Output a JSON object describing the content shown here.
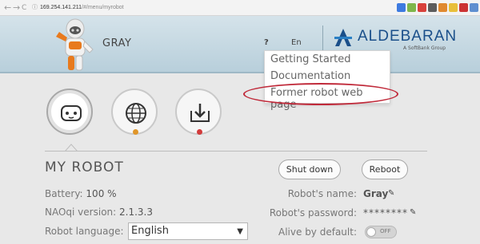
{
  "browser": {
    "url_host": "169.254.141.211",
    "url_path": "/#/menu/myrobot",
    "nav": {
      "back": "←",
      "forward": "→",
      "reload": "C",
      "info": "ⓘ"
    },
    "extension_colors": [
      "#3d7ae0",
      "#7fb64b",
      "#d8413b",
      "#5d5d5d",
      "#e0892f",
      "#e8bf3a",
      "#cc3333",
      "#5f8fd0"
    ]
  },
  "header": {
    "robot_name": "GRAY",
    "help": "?",
    "language": "En",
    "brand": "ALDEBARAN",
    "brand_sub": "A SoftBank Group",
    "brand_color": "#1a4f8a"
  },
  "dropdown": {
    "items": [
      "Getting Started",
      "Documentation",
      "Former robot web page"
    ],
    "highlight_color": "#c02a3a"
  },
  "icons": [
    {
      "name": "robot-face-icon",
      "active": true,
      "indicator": null
    },
    {
      "name": "globe-icon",
      "active": false,
      "indicator": "#e0962a"
    },
    {
      "name": "download-tray-icon",
      "active": false,
      "indicator": "#d23b3b"
    }
  ],
  "main": {
    "title": "MY ROBOT",
    "shutdown_label": "Shut down",
    "reboot_label": "Reboot",
    "battery_label": "Battery:",
    "battery_value": "100 %",
    "version_label": "NAOqi version:",
    "version_value": "2.1.3.3",
    "robot_language_label": "Robot language:",
    "language_value": "English",
    "robots_name_label": "Robot's name:",
    "robots_name_value": "Gray",
    "password_label": "Robot's password:",
    "password_value": "********",
    "alive_label": "Alive by default:",
    "alive_toggle_text": "OFF",
    "select_arrow": "▼",
    "pencil": "✎"
  }
}
